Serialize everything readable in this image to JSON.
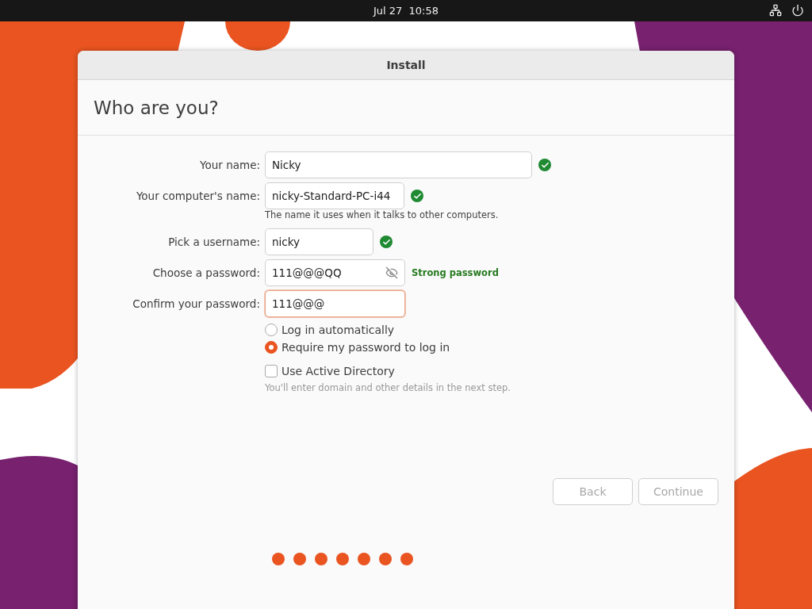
{
  "top_bar": {
    "date": "Jul 27",
    "time": "10:58"
  },
  "window": {
    "title": "Install"
  },
  "heading": "Who are you?",
  "fields": [
    {
      "label": "Your name:",
      "value": "Nicky",
      "kind": "text",
      "valid": true,
      "focused": false
    },
    {
      "label": "Your computer's name:",
      "value": "nicky-Standard-PC-i44",
      "kind": "text",
      "valid": true,
      "focused": false,
      "hint": "The name it uses when it talks to other computers."
    },
    {
      "label": "Pick a username:",
      "value": "nicky",
      "kind": "text",
      "valid": true,
      "focused": false
    },
    {
      "label": "Choose a password:",
      "value": "111@@@QQ",
      "kind": "password",
      "focused": false,
      "strength": "Strong password"
    },
    {
      "label": "Confirm your password:",
      "value": "111@@@",
      "kind": "password",
      "focused": true
    }
  ],
  "login_options": [
    {
      "label": "Log in automatically",
      "selected": false
    },
    {
      "label": "Require my password to log in",
      "selected": true
    }
  ],
  "active_directory": {
    "label": "Use Active Directory",
    "checked": false,
    "note": "You'll enter domain and other details in the next step."
  },
  "buttons": [
    {
      "label": "Back",
      "disabled": true
    },
    {
      "label": "Continue",
      "disabled": true
    }
  ],
  "progress_dots": [
    {
      "done": true
    },
    {
      "done": true
    },
    {
      "done": true
    },
    {
      "done": true
    },
    {
      "done": true
    },
    {
      "done": true
    },
    {
      "done": true
    }
  ]
}
